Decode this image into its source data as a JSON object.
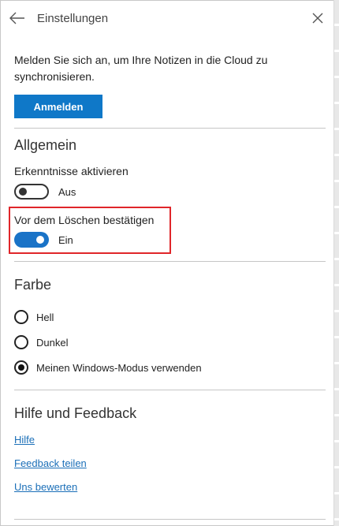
{
  "window": {
    "title": "Einstellungen"
  },
  "account": {
    "message": "Melden Sie sich an, um Ihre Notizen in die Cloud zu synchronisieren.",
    "signin_label": "Anmelden"
  },
  "general": {
    "title": "Allgemein",
    "insights": {
      "label": "Erkenntnisse aktivieren",
      "state": "Aus",
      "enabled": false
    },
    "confirm_delete": {
      "label": "Vor dem Löschen bestätigen",
      "state": "Ein",
      "enabled": true
    }
  },
  "color": {
    "title": "Farbe",
    "options": [
      {
        "label": "Hell",
        "selected": false
      },
      {
        "label": "Dunkel",
        "selected": false
      },
      {
        "label": "Meinen Windows-Modus verwenden",
        "selected": true
      }
    ]
  },
  "help": {
    "title": "Hilfe und Feedback",
    "links": [
      {
        "label": "Hilfe"
      },
      {
        "label": "Feedback teilen"
      },
      {
        "label": "Uns bewerten"
      }
    ]
  },
  "colors": {
    "accent": "#0f78c8",
    "toggle_on": "#1a73c7",
    "link": "#1b6fb8",
    "highlight": "#e0262a"
  },
  "icons": {
    "back": "back-arrow-icon",
    "close": "close-icon"
  }
}
